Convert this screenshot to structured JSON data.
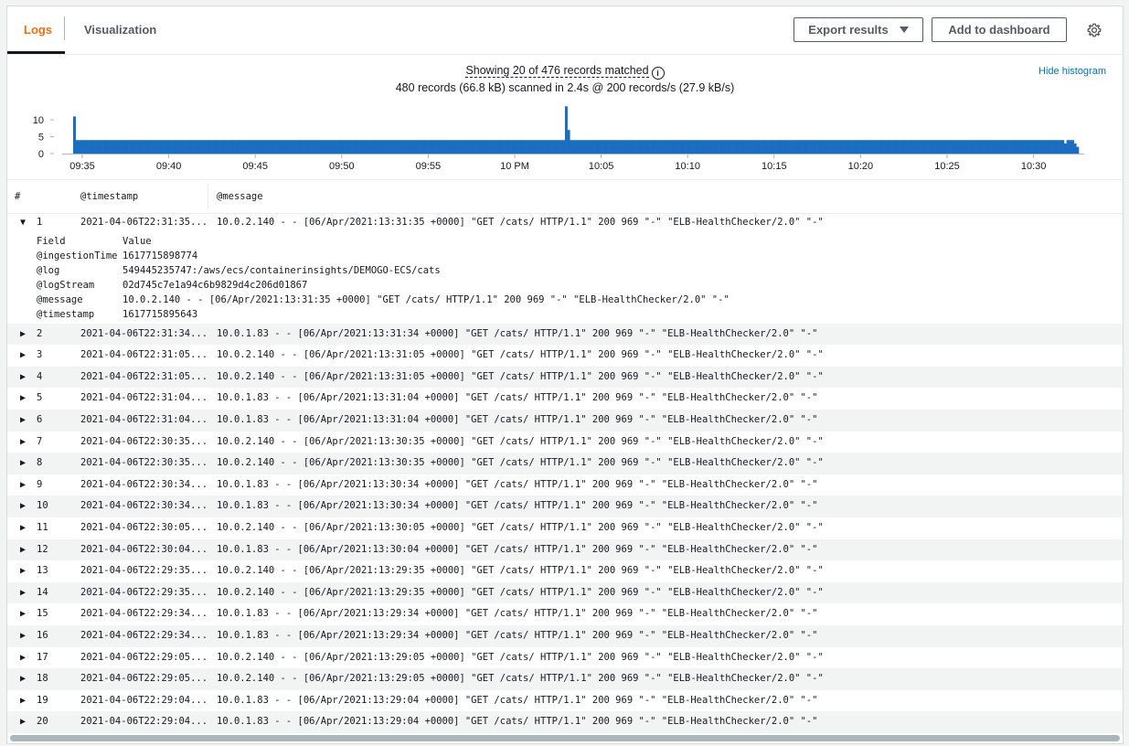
{
  "tabs": [
    {
      "label": "Logs",
      "active": true
    },
    {
      "label": "Visualization",
      "active": false
    }
  ],
  "toolbar": {
    "export_label": "Export results",
    "dashboard_label": "Add to dashboard"
  },
  "summary": {
    "showing": "Showing 20 of 476 records matched",
    "scanned": "480 records (66.8 kB) scanned in 2.4s @ 200 records/s (27.9 kB/s)",
    "hide_histogram": "Hide histogram"
  },
  "colors": {
    "accent": "#ec7211",
    "bar": "#1b6ebf",
    "link": "#0073bb"
  },
  "chart_data": {
    "type": "bar",
    "yticks": [
      "10",
      "5",
      "0"
    ],
    "ylim": [
      0,
      13
    ],
    "xticks": [
      "09:35",
      "09:40",
      "09:45",
      "09:50",
      "09:55",
      "10 PM",
      "10:05",
      "10:10",
      "10:15",
      "10:20",
      "10:25",
      "10:30"
    ],
    "values": [
      11,
      4,
      4,
      4,
      4,
      4,
      4,
      4,
      4,
      4,
      4,
      4,
      4,
      4,
      4,
      4,
      4,
      4,
      4,
      4,
      4,
      4,
      4,
      4,
      4,
      4,
      4,
      4,
      4,
      4,
      4,
      4,
      4,
      4,
      4,
      4,
      4,
      4,
      4,
      4,
      4,
      4,
      4,
      4,
      4,
      4,
      4,
      4,
      4,
      4,
      4,
      4,
      4,
      4,
      4,
      4,
      4,
      4,
      4,
      4,
      4,
      4,
      4,
      4,
      4,
      4,
      4,
      4,
      4,
      4,
      4,
      4,
      4,
      4,
      4,
      4,
      4,
      4,
      4,
      4,
      4,
      4,
      4,
      4,
      4,
      4,
      4,
      4,
      4,
      4,
      4,
      4,
      4,
      4,
      4,
      4,
      4,
      4,
      4,
      4,
      4,
      4,
      4,
      4,
      4,
      4,
      4,
      4,
      4,
      4,
      4,
      4,
      4,
      4,
      4,
      4,
      4,
      4,
      4,
      4,
      4,
      4,
      4,
      4,
      4,
      4,
      4,
      4,
      4,
      4,
      4,
      4,
      4,
      4,
      4,
      4,
      4,
      4,
      4,
      4,
      4,
      4,
      4,
      4,
      4,
      4,
      4,
      4,
      4,
      4,
      4,
      4,
      4,
      4,
      4,
      4,
      4,
      4,
      4,
      4,
      4,
      4,
      4,
      4,
      4,
      4,
      4,
      4,
      4,
      4,
      4,
      4,
      4,
      4,
      4,
      4,
      4,
      4,
      4,
      4,
      4,
      4,
      4,
      4,
      4,
      4,
      4,
      4,
      4,
      4,
      4,
      4,
      4,
      4,
      4,
      4,
      4,
      4,
      4,
      4,
      4,
      14,
      7,
      4,
      4,
      4,
      4,
      4,
      4,
      4,
      4,
      4,
      4,
      4,
      4,
      4,
      4,
      4,
      4,
      4,
      4,
      4,
      4,
      4,
      4,
      4,
      4,
      4,
      4,
      4,
      4,
      4,
      4,
      4,
      4,
      4,
      4,
      4,
      4,
      4,
      4,
      4,
      4,
      4,
      4,
      4,
      4,
      4,
      4,
      4,
      4,
      4,
      4,
      4,
      4,
      4,
      4,
      4,
      4,
      4,
      4,
      4,
      4,
      4,
      4,
      4,
      4,
      4,
      4,
      4,
      4,
      4,
      4,
      4,
      4,
      4,
      4,
      4,
      4,
      4,
      4,
      4,
      4,
      4,
      4,
      4,
      4,
      4,
      4,
      4,
      4,
      4,
      4,
      4,
      4,
      4,
      4,
      4,
      4,
      4,
      4,
      4,
      4,
      4,
      4,
      4,
      4,
      4,
      4,
      4,
      4,
      4,
      4,
      4,
      4,
      4,
      4,
      4,
      4,
      4,
      4,
      4,
      4,
      4,
      4,
      4,
      4,
      4,
      4,
      4,
      4,
      4,
      4,
      4,
      4,
      4,
      4,
      4,
      4,
      4,
      4,
      4,
      4,
      4,
      4,
      4,
      4,
      4,
      4,
      4,
      4,
      4,
      4,
      4,
      4,
      4,
      4,
      4,
      4,
      4,
      4,
      4,
      4,
      4,
      4,
      4,
      4,
      4,
      4,
      4,
      4,
      4,
      4,
      4,
      4,
      4,
      4,
      4,
      4,
      4,
      4,
      4,
      4,
      4,
      4,
      4,
      4,
      4,
      4,
      4,
      4,
      4,
      4,
      4,
      4,
      4,
      4,
      4,
      4,
      4,
      4,
      4,
      4,
      4,
      4,
      3,
      4,
      4,
      4,
      3,
      2
    ],
    "xlabel": "",
    "ylabel": ""
  },
  "table": {
    "headers": {
      "num": "#",
      "timestamp": "@timestamp",
      "message": "@message"
    },
    "expanded": {
      "num": "1",
      "timestamp": "2021-04-06T22:31:35...",
      "message": "10.0.2.140 - - [06/Apr/2021:13:31:35 +0000] \"GET /cats/ HTTP/1.1\" 200 969 \"-\" \"ELB-HealthChecker/2.0\" \"-\"",
      "field_header": "Field",
      "value_header": "Value",
      "fields": [
        {
          "key": "@ingestionTime",
          "value": "1617715898774"
        },
        {
          "key": "@log",
          "value": "549445235747:/aws/ecs/containerinsights/DEMOGO-ECS/cats"
        },
        {
          "key": "@logStream",
          "value": "02d745c7e1a94c6b9829d4c206d01867"
        },
        {
          "key": "@message",
          "value": "10.0.2.140 - - [06/Apr/2021:13:31:35 +0000] \"GET /cats/ HTTP/1.1\" 200 969 \"-\" \"ELB-HealthChecker/2.0\" \"-\""
        },
        {
          "key": "@timestamp",
          "value": "1617715895643"
        }
      ]
    },
    "rows": [
      {
        "num": "2",
        "timestamp": "2021-04-06T22:31:34...",
        "message": "10.0.1.83 - - [06/Apr/2021:13:31:34 +0000] \"GET /cats/ HTTP/1.1\" 200 969 \"-\" \"ELB-HealthChecker/2.0\" \"-\""
      },
      {
        "num": "3",
        "timestamp": "2021-04-06T22:31:05...",
        "message": "10.0.2.140 - - [06/Apr/2021:13:31:05 +0000] \"GET /cats/ HTTP/1.1\" 200 969 \"-\" \"ELB-HealthChecker/2.0\" \"-\""
      },
      {
        "num": "4",
        "timestamp": "2021-04-06T22:31:05...",
        "message": "10.0.2.140 - - [06/Apr/2021:13:31:05 +0000] \"GET /cats/ HTTP/1.1\" 200 969 \"-\" \"ELB-HealthChecker/2.0\" \"-\""
      },
      {
        "num": "5",
        "timestamp": "2021-04-06T22:31:04...",
        "message": "10.0.1.83 - - [06/Apr/2021:13:31:04 +0000] \"GET /cats/ HTTP/1.1\" 200 969 \"-\" \"ELB-HealthChecker/2.0\" \"-\""
      },
      {
        "num": "6",
        "timestamp": "2021-04-06T22:31:04...",
        "message": "10.0.1.83 - - [06/Apr/2021:13:31:04 +0000] \"GET /cats/ HTTP/1.1\" 200 969 \"-\" \"ELB-HealthChecker/2.0\" \"-\""
      },
      {
        "num": "7",
        "timestamp": "2021-04-06T22:30:35...",
        "message": "10.0.2.140 - - [06/Apr/2021:13:30:35 +0000] \"GET /cats/ HTTP/1.1\" 200 969 \"-\" \"ELB-HealthChecker/2.0\" \"-\""
      },
      {
        "num": "8",
        "timestamp": "2021-04-06T22:30:35...",
        "message": "10.0.2.140 - - [06/Apr/2021:13:30:35 +0000] \"GET /cats/ HTTP/1.1\" 200 969 \"-\" \"ELB-HealthChecker/2.0\" \"-\""
      },
      {
        "num": "9",
        "timestamp": "2021-04-06T22:30:34...",
        "message": "10.0.1.83 - - [06/Apr/2021:13:30:34 +0000] \"GET /cats/ HTTP/1.1\" 200 969 \"-\" \"ELB-HealthChecker/2.0\" \"-\""
      },
      {
        "num": "10",
        "timestamp": "2021-04-06T22:30:34...",
        "message": "10.0.1.83 - - [06/Apr/2021:13:30:34 +0000] \"GET /cats/ HTTP/1.1\" 200 969 \"-\" \"ELB-HealthChecker/2.0\" \"-\""
      },
      {
        "num": "11",
        "timestamp": "2021-04-06T22:30:05...",
        "message": "10.0.2.140 - - [06/Apr/2021:13:30:05 +0000] \"GET /cats/ HTTP/1.1\" 200 969 \"-\" \"ELB-HealthChecker/2.0\" \"-\""
      },
      {
        "num": "12",
        "timestamp": "2021-04-06T22:30:04...",
        "message": "10.0.1.83 - - [06/Apr/2021:13:30:04 +0000] \"GET /cats/ HTTP/1.1\" 200 969 \"-\" \"ELB-HealthChecker/2.0\" \"-\""
      },
      {
        "num": "13",
        "timestamp": "2021-04-06T22:29:35...",
        "message": "10.0.2.140 - - [06/Apr/2021:13:29:35 +0000] \"GET /cats/ HTTP/1.1\" 200 969 \"-\" \"ELB-HealthChecker/2.0\" \"-\""
      },
      {
        "num": "14",
        "timestamp": "2021-04-06T22:29:35...",
        "message": "10.0.2.140 - - [06/Apr/2021:13:29:35 +0000] \"GET /cats/ HTTP/1.1\" 200 969 \"-\" \"ELB-HealthChecker/2.0\" \"-\""
      },
      {
        "num": "15",
        "timestamp": "2021-04-06T22:29:34...",
        "message": "10.0.1.83 - - [06/Apr/2021:13:29:34 +0000] \"GET /cats/ HTTP/1.1\" 200 969 \"-\" \"ELB-HealthChecker/2.0\" \"-\""
      },
      {
        "num": "16",
        "timestamp": "2021-04-06T22:29:34...",
        "message": "10.0.1.83 - - [06/Apr/2021:13:29:34 +0000] \"GET /cats/ HTTP/1.1\" 200 969 \"-\" \"ELB-HealthChecker/2.0\" \"-\""
      },
      {
        "num": "17",
        "timestamp": "2021-04-06T22:29:05...",
        "message": "10.0.2.140 - - [06/Apr/2021:13:29:05 +0000] \"GET /cats/ HTTP/1.1\" 200 969 \"-\" \"ELB-HealthChecker/2.0\" \"-\""
      },
      {
        "num": "18",
        "timestamp": "2021-04-06T22:29:05...",
        "message": "10.0.2.140 - - [06/Apr/2021:13:29:05 +0000] \"GET /cats/ HTTP/1.1\" 200 969 \"-\" \"ELB-HealthChecker/2.0\" \"-\""
      },
      {
        "num": "19",
        "timestamp": "2021-04-06T22:29:04...",
        "message": "10.0.1.83 - - [06/Apr/2021:13:29:04 +0000] \"GET /cats/ HTTP/1.1\" 200 969 \"-\" \"ELB-HealthChecker/2.0\" \"-\""
      },
      {
        "num": "20",
        "timestamp": "2021-04-06T22:29:04...",
        "message": "10.0.1.83 - - [06/Apr/2021:13:29:04 +0000] \"GET /cats/ HTTP/1.1\" 200 969 \"-\" \"ELB-HealthChecker/2.0\" \"-\""
      }
    ]
  }
}
